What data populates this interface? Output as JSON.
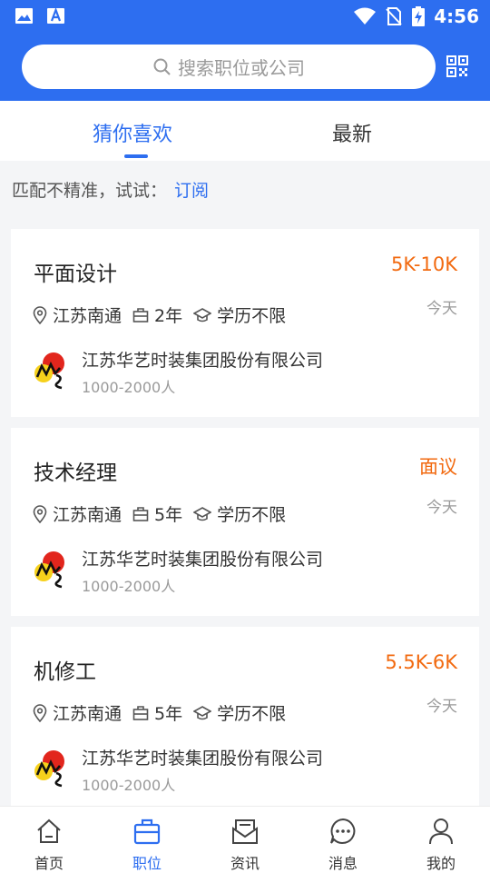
{
  "status_bar": {
    "time": "4:56"
  },
  "search": {
    "placeholder": "搜索职位或公司"
  },
  "tabs": [
    {
      "label": "猜你喜欢"
    },
    {
      "label": "最新"
    }
  ],
  "hint": {
    "text": "匹配不精准，试试：",
    "link": "订阅"
  },
  "jobs": [
    {
      "title": "平面设计",
      "salary": "5K-10K",
      "date": "今天",
      "location": "江苏南通",
      "experience": "2年",
      "education": "学历不限",
      "company": "江苏华艺时装集团股份有限公司",
      "size": "1000-2000人"
    },
    {
      "title": "技术经理",
      "salary": "面议",
      "date": "今天",
      "location": "江苏南通",
      "experience": "5年",
      "education": "学历不限",
      "company": "江苏华艺时装集团股份有限公司",
      "size": "1000-2000人"
    },
    {
      "title": "机修工",
      "salary": "5.5K-6K",
      "date": "今天",
      "location": "江苏南通",
      "experience": "5年",
      "education": "学历不限",
      "company": "江苏华艺时装集团股份有限公司",
      "size": "1000-2000人"
    }
  ],
  "nav": [
    {
      "label": "首页",
      "icon": "home-icon"
    },
    {
      "label": "职位",
      "icon": "briefcase-icon"
    },
    {
      "label": "资讯",
      "icon": "news-icon"
    },
    {
      "label": "消息",
      "icon": "message-icon"
    },
    {
      "label": "我的",
      "icon": "profile-icon"
    }
  ],
  "colors": {
    "primary": "#2d6ef0",
    "salary": "#f26a10",
    "background": "#f4f5f7"
  }
}
